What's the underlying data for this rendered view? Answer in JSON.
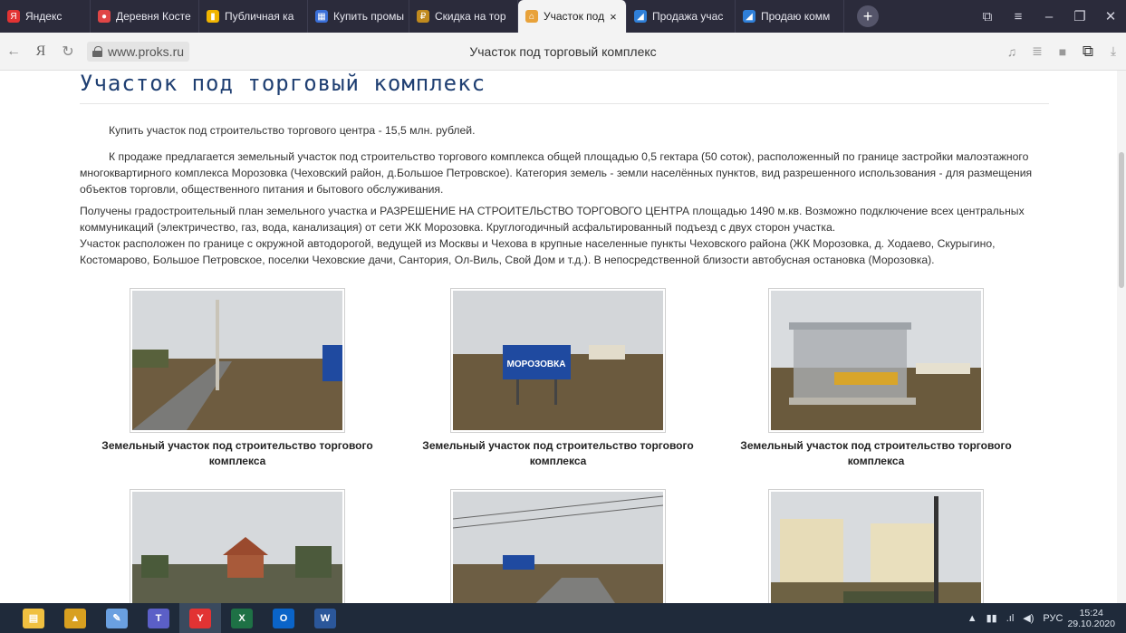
{
  "browser": {
    "tabs": [
      {
        "label": "Яндекс",
        "color": "#e23333",
        "glyph": "Я"
      },
      {
        "label": "Деревня Косте",
        "color": "#e04646",
        "glyph": "●"
      },
      {
        "label": "Публичная ка",
        "color": "#f0b400",
        "glyph": "▮"
      },
      {
        "label": "Купить промы",
        "color": "#3a6fd8",
        "glyph": "▦"
      },
      {
        "label": "Скидка на тор",
        "color": "#c08a1e",
        "glyph": "₽"
      },
      {
        "label": "Участок под",
        "color": "#e8a23a",
        "glyph": "⌂",
        "active": true
      },
      {
        "label": "Продажа учас",
        "color": "#2f7fd8",
        "glyph": "◢"
      },
      {
        "label": "Продаю комм",
        "color": "#2f7fd8",
        "glyph": "◢"
      }
    ],
    "tab_close": "×",
    "add_tab": "+",
    "url_domain": "www.proks.ru",
    "page_title": "Участок под торговый комплекс",
    "nav": {
      "back": "←",
      "yandex": "Я",
      "reload": "↻"
    }
  },
  "page": {
    "heading": "Участок под торговый комплекс",
    "p1": "Купить участок под строительство торгового центра - 15,5 млн. рублей.",
    "p2": "К продаже предлагается земельный участок под строительство торгового комплекса общей площадью 0,5 гектара (50 соток), расположенный по границе застройки малоэтажного многоквартирного комплекса Морозовка (Чеховский район, д.Большое Петровское). Категория земель - земли населённых пунктов, вид разрешенного использования - для размещения объектов торговли, общественного питания и бытового обслуживания.",
    "p3": "Получены градостроительный план земельного участка и РАЗРЕШЕНИЕ НА СТРОИТЕЛЬСТВО ТОРГОВОГО ЦЕНТРА площадью 1490 м.кв. Возможно подключение всех центральных коммуникаций (электричество, газ, вода, канализация) от сети ЖК Морозовка. Круглогодичный асфальтированный подъезд с двух сторон участка.",
    "p4": "Участок расположен по границе с окружной автодорогой, ведущей из Москвы и Чехова в крупные населенные пункты Чеховского района (ЖК Морозовка, д. Ходаево, Скурыгино, Костомарово, Большое Петровское, поселки Чеховские дачи, Сантория, Ол-Виль, Свой Дом и т.д.). В непосредственной близости автобусная остановка (Морозовка).",
    "captions": [
      "Земельный участок под строительство торгового комплекса",
      "Земельный участок под строительство торгового комплекса",
      "Земельный участок под строительство торгового комплекса"
    ],
    "sign_text": "МОРОЗОВКА"
  },
  "taskbar": {
    "apps": [
      {
        "name": "file-explorer",
        "color": "#f0c040",
        "glyph": "▤"
      },
      {
        "name": "app-2",
        "color": "#d8a020",
        "glyph": "▲"
      },
      {
        "name": "paint",
        "color": "#6aa0e0",
        "glyph": "✎"
      },
      {
        "name": "teams",
        "color": "#5b5fc7",
        "glyph": "T"
      },
      {
        "name": "yandex-browser",
        "color": "#e23333",
        "glyph": "Y",
        "active": true
      },
      {
        "name": "excel",
        "color": "#1e7145",
        "glyph": "X"
      },
      {
        "name": "outlook",
        "color": "#0a64c8",
        "glyph": "O"
      },
      {
        "name": "word",
        "color": "#2b579a",
        "glyph": "W"
      }
    ],
    "lang": "РУС",
    "time": "15:24",
    "date": "29.10.2020"
  }
}
